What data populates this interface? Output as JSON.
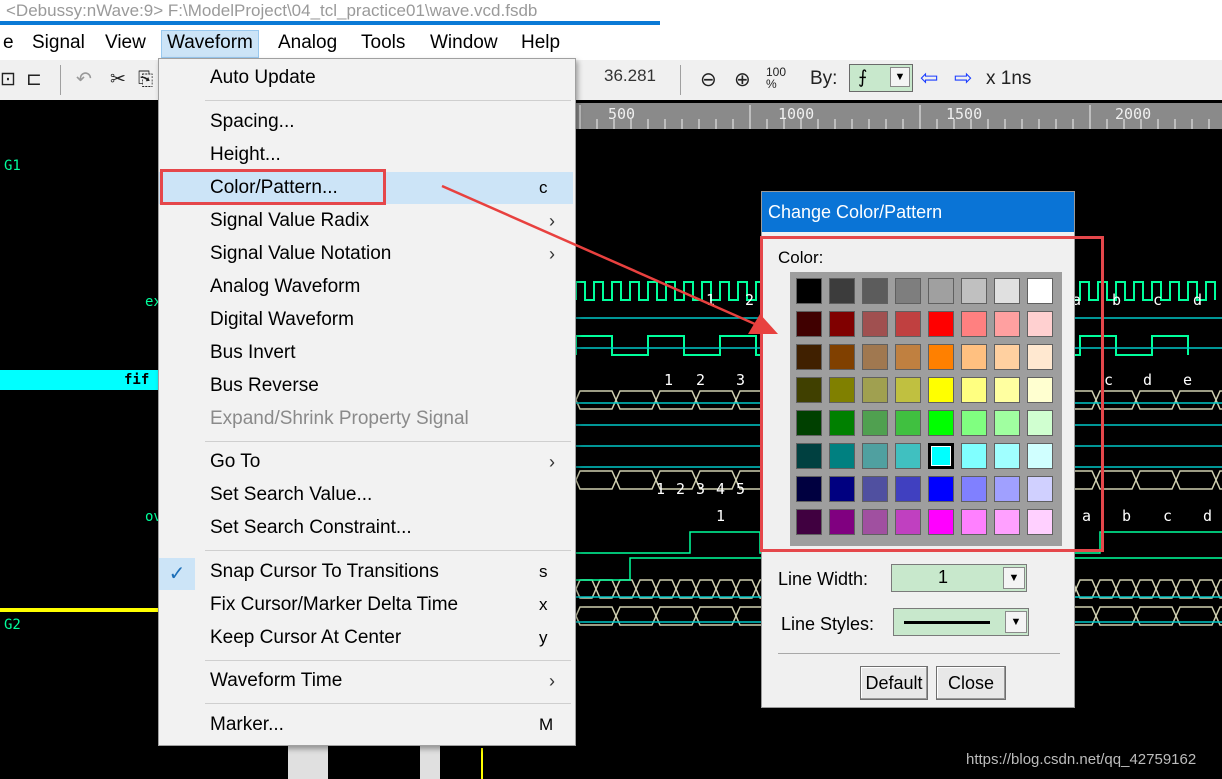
{
  "window": {
    "title": "<Debussy:nWave:9> F:\\ModelProject\\04_tcl_practice01\\wave.vcd.fsdb"
  },
  "menubar": {
    "items": [
      {
        "label": "e"
      },
      {
        "label": "Signal"
      },
      {
        "label": "View"
      },
      {
        "label": "Waveform"
      },
      {
        "label": "Analog"
      },
      {
        "label": "Tools"
      },
      {
        "label": "Window"
      },
      {
        "label": "Help"
      }
    ]
  },
  "toolbar": {
    "time_value": "36.281",
    "by_label": "By:",
    "step_label": "x 1ns"
  },
  "ruler": {
    "ticks": [
      "500",
      "1000",
      "1500",
      "2000"
    ]
  },
  "signals": {
    "group1": "G1",
    "group2": "G2",
    "s1": "ex",
    "s2": "fif",
    "s3": "ov"
  },
  "bus_values": {
    "row1": [
      "1",
      "2",
      "a",
      "b",
      "c",
      "d"
    ],
    "row2": [
      "1",
      "2",
      "3",
      "c",
      "d",
      "e"
    ],
    "row3": [
      "1",
      "2",
      "3",
      "4",
      "5"
    ],
    "row4": [
      "1",
      "a",
      "b",
      "c",
      "d"
    ]
  },
  "waveform_menu": {
    "items": [
      {
        "label": "Auto Update",
        "shortcut": ""
      },
      {
        "label": "Spacing...",
        "shortcut": ""
      },
      {
        "label": "Height...",
        "shortcut": ""
      },
      {
        "label": "Color/Pattern...",
        "shortcut": "c"
      },
      {
        "label": "Signal Value Radix",
        "shortcut": "›"
      },
      {
        "label": "Signal Value Notation",
        "shortcut": "›"
      },
      {
        "label": "Analog Waveform",
        "shortcut": ""
      },
      {
        "label": "Digital Waveform",
        "shortcut": ""
      },
      {
        "label": "Bus Invert",
        "shortcut": ""
      },
      {
        "label": "Bus Reverse",
        "shortcut": ""
      },
      {
        "label": "Expand/Shrink Property Signal",
        "shortcut": ""
      },
      {
        "label": "Go To",
        "shortcut": "›"
      },
      {
        "label": "Set Search Value...",
        "shortcut": ""
      },
      {
        "label": "Set Search Constraint...",
        "shortcut": ""
      },
      {
        "label": "Snap Cursor To Transitions",
        "shortcut": "s",
        "checked": true
      },
      {
        "label": "Fix Cursor/Marker Delta Time",
        "shortcut": "x"
      },
      {
        "label": "Keep Cursor At Center",
        "shortcut": "y"
      },
      {
        "label": "Waveform Time",
        "shortcut": "›"
      },
      {
        "label": "Marker...",
        "shortcut": "M"
      }
    ]
  },
  "dialog": {
    "title": "Change Color/Pattern",
    "color_label": "Color:",
    "line_width_label": "Line Width:",
    "line_width_value": "1",
    "line_styles_label": "Line Styles:",
    "default_button": "Default",
    "close_button": "Close",
    "selected_color": "#00ffff",
    "palette": [
      [
        "#000000",
        "#3c3c3c",
        "#5c5c5c",
        "#7e7e7e",
        "#a0a0a0",
        "#c0c0c0",
        "#e0e0e0",
        "#ffffff"
      ],
      [
        "#400000",
        "#800000",
        "#a05050",
        "#c04040",
        "#ff0000",
        "#ff8080",
        "#ffa0a0",
        "#ffd0d0"
      ],
      [
        "#402000",
        "#804000",
        "#a07850",
        "#c08040",
        "#ff8000",
        "#ffc080",
        "#ffd0a0",
        "#ffe8d0"
      ],
      [
        "#404000",
        "#808000",
        "#a0a050",
        "#c0c040",
        "#ffff00",
        "#ffff80",
        "#ffffa0",
        "#ffffd0"
      ],
      [
        "#004000",
        "#008000",
        "#50a050",
        "#40c040",
        "#00ff00",
        "#80ff80",
        "#a0ffa0",
        "#d0ffd0"
      ],
      [
        "#004040",
        "#008080",
        "#50a0a0",
        "#40c0c0",
        "#00ffff",
        "#80ffff",
        "#a0ffff",
        "#d0ffff"
      ],
      [
        "#000040",
        "#000080",
        "#5050a0",
        "#4040c0",
        "#0000ff",
        "#8080ff",
        "#a0a0ff",
        "#d0d0ff"
      ],
      [
        "#400040",
        "#800080",
        "#a050a0",
        "#c040c0",
        "#ff00ff",
        "#ff80ff",
        "#ffa0ff",
        "#ffd0ff"
      ]
    ]
  },
  "watermark": "https://blog.csdn.net/qq_42759162"
}
